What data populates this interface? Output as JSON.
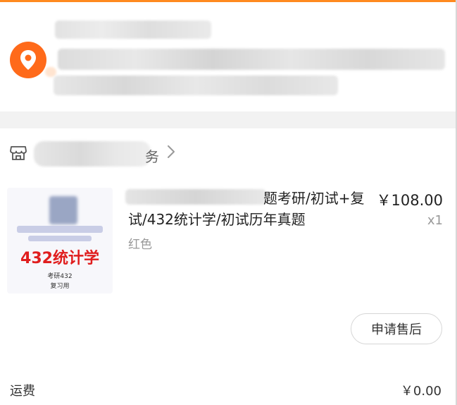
{
  "colors": {
    "accent": "#ff6a1a",
    "price_red": "#e01e1e",
    "muted": "#999999"
  },
  "address": {
    "icon": "location-pin-icon"
  },
  "shop": {
    "icon": "store-icon",
    "name_suffix": "务",
    "chevron": "chevron-right-icon"
  },
  "product": {
    "thumbnail": {
      "headline": "432统计学",
      "line1": "考研432",
      "line2": "复习用"
    },
    "title_visible": "题考研/初试+复试/432统计学/初试历年真题",
    "price": "￥108.00",
    "quantity": "x1",
    "variant": "红色"
  },
  "actions": {
    "after_sale": "申请售后"
  },
  "shipping": {
    "label": "运费",
    "value": "￥0.00"
  }
}
